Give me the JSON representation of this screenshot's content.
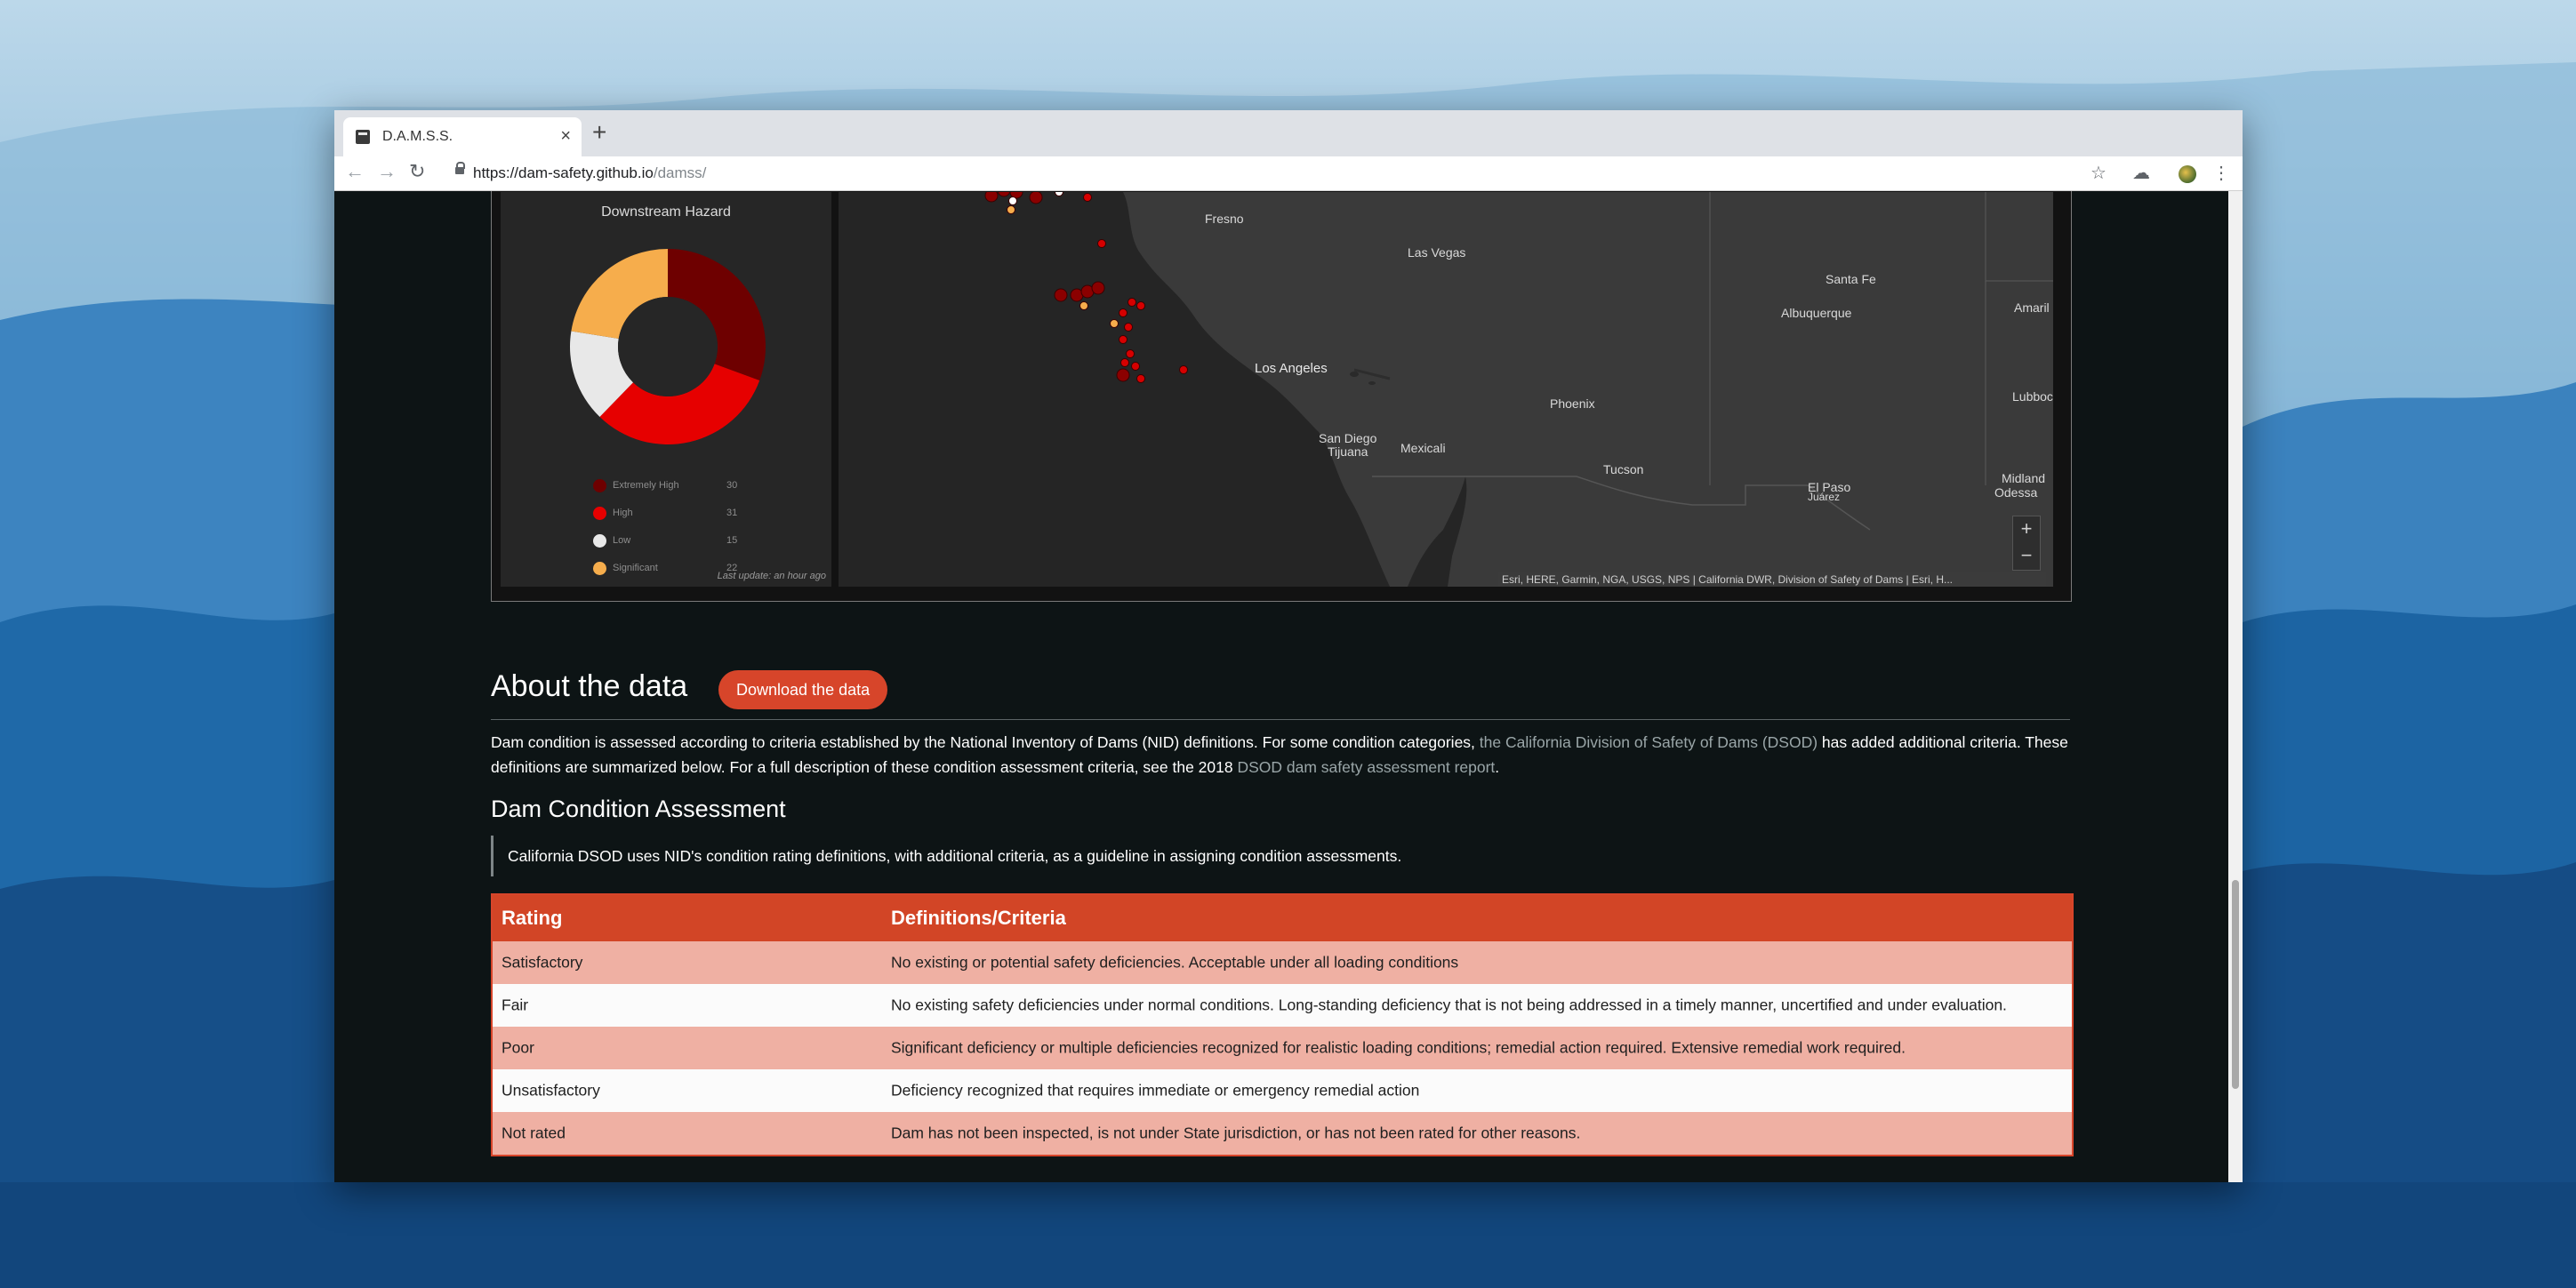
{
  "browser": {
    "tab_title": "D.A.M.S.S.",
    "url_host": "https://dam-safety.github.io",
    "url_path": "/damss/"
  },
  "dashboard": {
    "hazard_title": "Downstream Hazard",
    "chart_data": {
      "type": "pie",
      "title": "Downstream Hazard",
      "categories": [
        "Extremely High",
        "High",
        "Low",
        "Significant"
      ],
      "values": [
        30,
        31,
        15,
        22
      ],
      "colors": [
        "#6e0000",
        "#e60000",
        "#e8e8e8",
        "#f6ad4c"
      ],
      "donut": true
    },
    "legend": [
      {
        "label": "Extremely High",
        "value": "30",
        "color": "#6e0000"
      },
      {
        "label": "High",
        "value": "31",
        "color": "#e60000"
      },
      {
        "label": "Low",
        "value": "15",
        "color": "#e8e8e8"
      },
      {
        "label": "Significant",
        "value": "22",
        "color": "#f6ad4c"
      }
    ],
    "last_update": "Last update: an hour ago",
    "map": {
      "cities": {
        "fresno": "Fresno",
        "las_vegas": "Las Vegas",
        "santa_fe": "Santa Fe",
        "albuquerque": "Albuquerque",
        "amarillo": "Amaril",
        "los_angeles": "Los Angeles",
        "phoenix": "Phoenix",
        "lubbock": "Lubboc",
        "san_diego": "San Diego",
        "tijuana": "Tijuana",
        "mexicali": "Mexicali",
        "tucson": "Tucson",
        "el_paso": "El Paso",
        "juarez": "Juárez",
        "midland": "Midland",
        "odessa": "Odessa"
      },
      "zoom_in": "+",
      "zoom_out": "−",
      "attribution": "Esri, HERE, Garmin, NGA, USGS, NPS | California DWR, Division of Safety of Dams | Esri, H..."
    }
  },
  "about": {
    "heading": "About the data",
    "download_label": "Download the data",
    "para_part1": "Dam condition is assessed according to criteria established by the National Inventory of Dams (NID) definitions. For some condition categories, ",
    "para_link1": "the California Division of Safety of Dams (DSOD)",
    "para_part2": " has added additional criteria. These definitions are summarized below. For a full description of these condition assessment criteria, see the 2018 ",
    "para_link2": "DSOD dam safety assessment report",
    "para_part3": "."
  },
  "assessment": {
    "heading": "Dam Condition Assessment",
    "quote": "California DSOD uses NID's condition rating definitions, with additional criteria, as a guideline in assigning condition assessments.",
    "table": {
      "headers": [
        "Rating",
        "Definitions/Criteria"
      ],
      "rows": [
        [
          "Satisfactory",
          "No existing or potential safety deficiencies. Acceptable under all loading conditions"
        ],
        [
          "Fair",
          "No existing safety deficiencies under normal conditions. Long-standing deficiency that is not being addressed in a timely manner, uncertified and under evaluation."
        ],
        [
          "Poor",
          "Significant deficiency or multiple deficiencies recognized for realistic loading conditions; remedial action required. Extensive remedial work required."
        ],
        [
          "Unsatisfactory",
          "Deficiency recognized that requires immediate or emergency remedial action"
        ],
        [
          "Not rated",
          "Dam has not been inspected, is not under State jurisdiction, or has not been rated for other reasons."
        ]
      ]
    }
  }
}
